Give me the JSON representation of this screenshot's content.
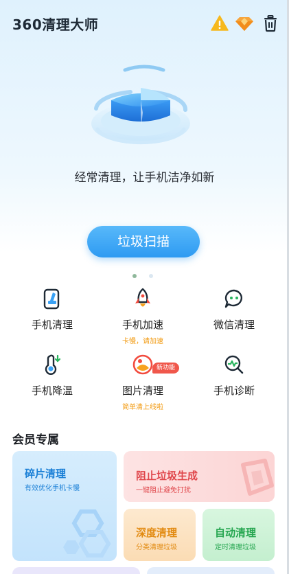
{
  "header": {
    "logo_text": "360清理大师",
    "icons": [
      "warning-icon",
      "diamond-icon",
      "trash-icon"
    ]
  },
  "hero": {
    "slogan": "经常清理，让手机洁净如新",
    "scan_button": "垃圾扫描"
  },
  "tools": [
    {
      "label": "手机清理",
      "sub": "",
      "icon": "phone-clean-icon"
    },
    {
      "label": "手机加速",
      "sub": "卡慢，请加速",
      "icon": "rocket-icon"
    },
    {
      "label": "微信清理",
      "sub": "",
      "icon": "wechat-icon"
    },
    {
      "label": "手机降温",
      "sub": "",
      "icon": "thermometer-icon"
    },
    {
      "label": "图片清理",
      "sub": "简单清上线啦",
      "icon": "image-icon",
      "badge": "新功能"
    },
    {
      "label": "手机诊断",
      "sub": "",
      "icon": "diagnose-icon"
    }
  ],
  "member": {
    "title": "会员专属",
    "cards": [
      {
        "title": "碎片清理",
        "subtitle": "有效优化手机卡慢"
      },
      {
        "title": "阻止垃圾生成",
        "subtitle": "一键阻止避免打扰"
      },
      {
        "title": "深度清理",
        "subtitle": "分类清理垃圾"
      },
      {
        "title": "自动清理",
        "subtitle": "定时清理垃圾"
      }
    ]
  },
  "colors": {
    "accent_blue": "#2e9af2",
    "orange": "#f29a10",
    "red": "#e0474c",
    "green": "#26a650"
  }
}
